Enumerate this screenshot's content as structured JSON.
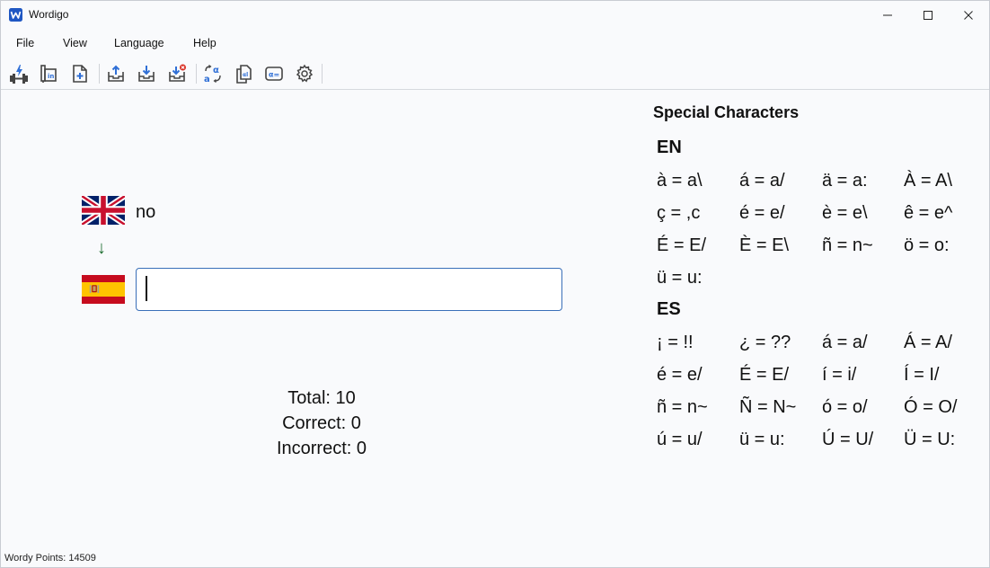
{
  "window": {
    "title": "Wordigo",
    "icons": {
      "app": "wordigo-w-icon",
      "minimize": "minimize-icon",
      "maximize": "maximize-icon",
      "close": "close-icon"
    }
  },
  "menu": {
    "items": [
      "File",
      "View",
      "Language",
      "Help"
    ]
  },
  "toolbar": {
    "tools": [
      "dumbbell-practice-icon",
      "swap-languages-icon",
      "new-file-icon",
      "upload-icon",
      "download-icon",
      "download-remove-icon",
      "translate-alpha-icon",
      "copy-document-icon",
      "alpha-equals-icon",
      "settings-gear-icon"
    ]
  },
  "quiz": {
    "source_flag": "uk-flag-icon",
    "target_flag": "spain-flag-icon",
    "source_word": "no",
    "direction_arrow": "↓",
    "answer_value": "",
    "stats": {
      "total": "Total: 10",
      "correct": "Correct: 0",
      "incorrect": "Incorrect: 0"
    }
  },
  "special_characters": {
    "title": "Special Characters",
    "sections": [
      {
        "lang": "EN",
        "rows": [
          [
            "à = a\\",
            "á = a/",
            "ä = a:",
            "À = A\\"
          ],
          [
            "ç = ,c",
            "é = e/",
            "è = e\\",
            "ê = e^"
          ],
          [
            "É = E/",
            "È = E\\",
            "ñ = n~",
            "ö = o:"
          ],
          [
            "ü = u:"
          ]
        ]
      },
      {
        "lang": "ES",
        "rows": [
          [
            "¡ = !!",
            "¿ = ??",
            "á = a/",
            "Á = A/"
          ],
          [
            "é = e/",
            "É = E/",
            "í = i/",
            "Í = I/"
          ],
          [
            "ñ = n~",
            "Ñ = N~",
            "ó = o/",
            "Ó = O/"
          ],
          [
            "ú = u/",
            "ü = u:",
            "Ú = U/",
            "Ü = U:"
          ]
        ]
      }
    ]
  },
  "status_bar": {
    "text": "Wordy Points: 14509"
  },
  "colors": {
    "accent_blue": "#3a6fb8",
    "arrow_green": "#1b6b2e",
    "background": "#f9fafc"
  }
}
